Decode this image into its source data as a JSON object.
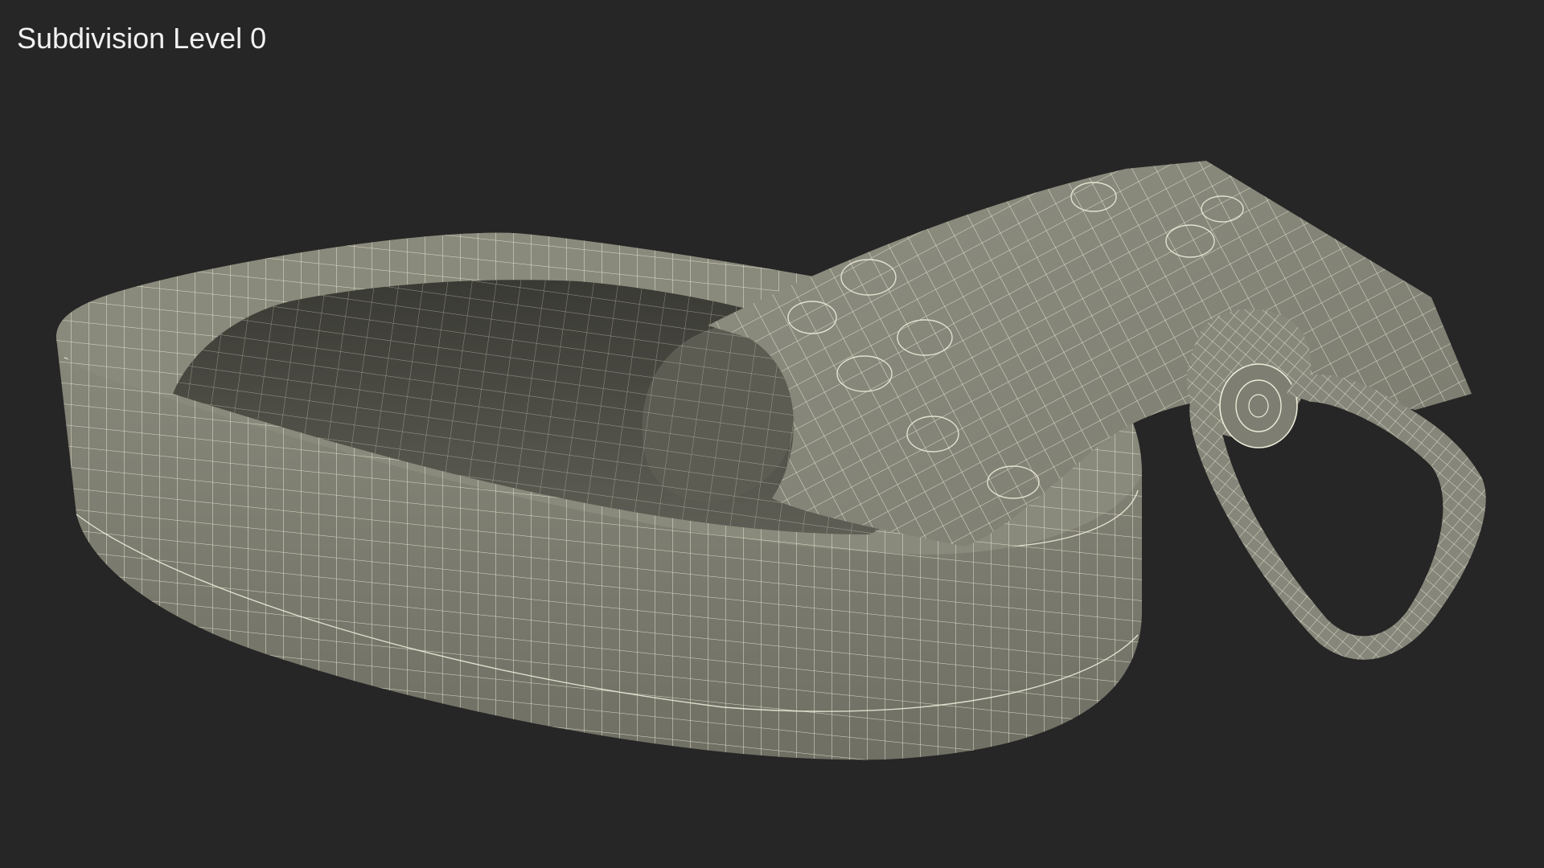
{
  "viewport": {
    "label": "Subdivision Level 0"
  },
  "render": {
    "background_color": "#262626",
    "surface_color": "#8c8c7e",
    "surface_shadow_color": "#55554c",
    "interior_color": "#4a4a42",
    "wire_color": "#ecebd8",
    "shading": "wireframe-on-shaded"
  },
  "model": {
    "subject": "open sardine can with rolled-back lid and pull ring",
    "parts": [
      "can-body",
      "can-rim",
      "can-interior",
      "rolled-lid",
      "pull-ring"
    ]
  }
}
